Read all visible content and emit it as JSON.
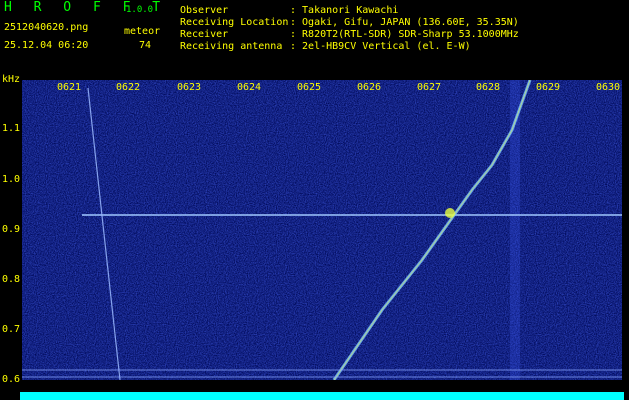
{
  "header": {
    "app_name": "H R O F F T",
    "version": "1.0.0",
    "filename": "2512040620.png",
    "datetime": "25.12.04 06:20",
    "meteor_label": "meteor",
    "meteor_count": "74",
    "info_labels": [
      "Observer",
      "Receiving Location",
      "Receiver",
      "Receiving antenna"
    ],
    "info_values": [
      ": Takanori Kawachi",
      ": Ogaki, Gifu, JAPAN (136.60E, 35.35N)",
      ": R820T2(RTL-SDR) SDR-Sharp 53.1000MHz",
      ": 2el-HB9CV Vertical (el. E-W)"
    ]
  },
  "axes": {
    "y_unit": "kHz",
    "y_ticks": [
      "1.1",
      "1.0",
      "0.9",
      "0.8",
      "0.7",
      "0.6"
    ],
    "x_ticks": [
      "0621",
      "0622",
      "0623",
      "0624",
      "0625",
      "0626",
      "0627",
      "0628",
      "0629",
      "0630"
    ]
  }
}
